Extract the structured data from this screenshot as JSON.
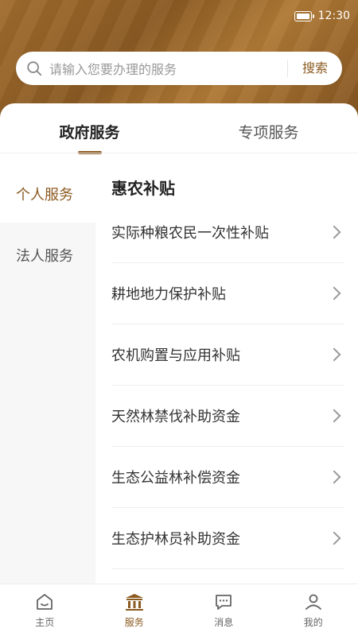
{
  "status_bar": {
    "time": "12:30"
  },
  "search": {
    "placeholder": "请输入您要办理的服务",
    "button_label": "搜索"
  },
  "tabs": [
    {
      "label": "政府服务",
      "active": true
    },
    {
      "label": "专项服务",
      "active": false
    }
  ],
  "sidebar": {
    "items": [
      {
        "label": "个人服务",
        "active": true
      },
      {
        "label": "法人服务",
        "active": false
      }
    ]
  },
  "section": {
    "title": "惠农补贴",
    "items": [
      {
        "label": "实际种粮农民一次性补贴"
      },
      {
        "label": "耕地地力保护补贴"
      },
      {
        "label": "农机购置与应用补贴"
      },
      {
        "label": "天然林禁伐补助资金"
      },
      {
        "label": "生态公益林补偿资金"
      },
      {
        "label": "生态护林员补助资金"
      }
    ]
  },
  "bottom_nav": {
    "items": [
      {
        "label": "主页",
        "icon": "home-icon"
      },
      {
        "label": "服务",
        "icon": "government-building-icon",
        "active": true
      },
      {
        "label": "消息",
        "icon": "message-icon"
      },
      {
        "label": "我的",
        "icon": "user-icon"
      }
    ]
  },
  "colors": {
    "accent": "#8b5a20",
    "header_bg": "#9a6a2c"
  }
}
